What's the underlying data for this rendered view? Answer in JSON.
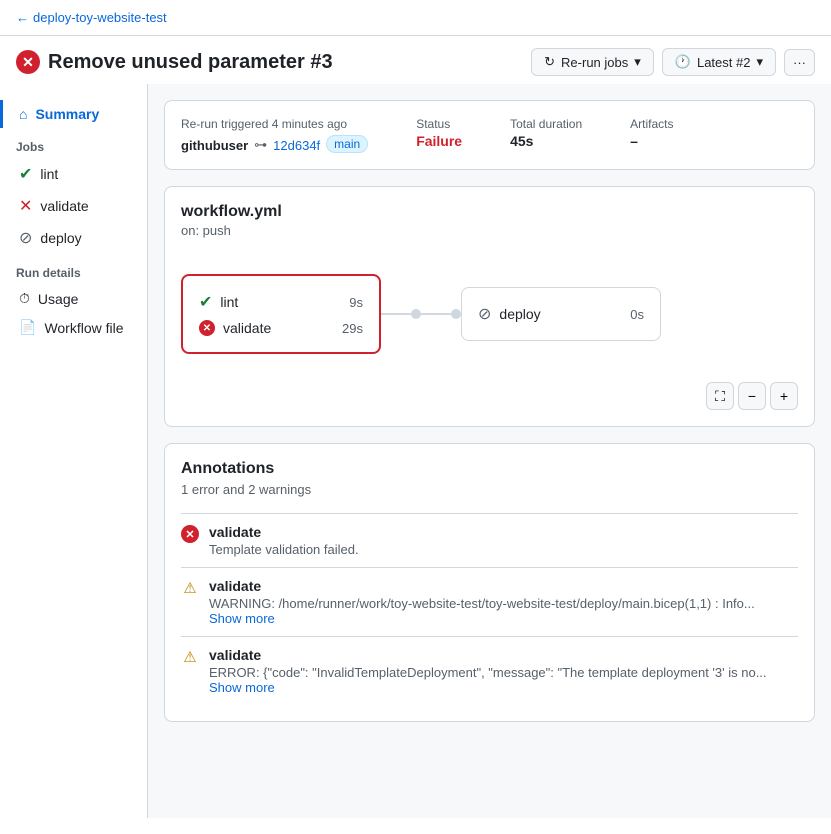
{
  "breadcrumb": {
    "back_text": "deploy-toy-website-test"
  },
  "header": {
    "title": "Remove unused parameter #3",
    "actions": {
      "rerun_label": "Re-run jobs",
      "latest_label": "Latest #2",
      "more_label": "···"
    }
  },
  "sidebar": {
    "summary_label": "Summary",
    "jobs_section": "Jobs",
    "jobs": [
      {
        "name": "lint",
        "status": "success"
      },
      {
        "name": "validate",
        "status": "failure"
      },
      {
        "name": "deploy",
        "status": "skipped"
      }
    ],
    "run_details_section": "Run details",
    "run_details": [
      {
        "name": "Usage",
        "icon": "clock"
      },
      {
        "name": "Workflow file",
        "icon": "workflow"
      }
    ]
  },
  "summary_card": {
    "triggered_label": "Re-run triggered 4 minutes ago",
    "user": "githubuser",
    "commit": "12d634f",
    "branch": "main",
    "status_label": "Status",
    "status_value": "Failure",
    "duration_label": "Total duration",
    "duration_value": "45s",
    "artifacts_label": "Artifacts",
    "artifacts_value": "–"
  },
  "workflow_card": {
    "filename": "workflow.yml",
    "trigger": "on: push",
    "jobs": [
      {
        "name": "lint",
        "status": "success",
        "duration": "9s",
        "highlighted": true
      },
      {
        "name": "validate",
        "status": "failure",
        "duration": "29s",
        "highlighted": true
      }
    ],
    "deploy_job": {
      "name": "deploy",
      "status": "skipped",
      "duration": "0s"
    }
  },
  "annotations": {
    "title": "Annotations",
    "subtitle": "1 error and 2 warnings",
    "items": [
      {
        "type": "error",
        "job": "validate",
        "message": "Template validation failed.",
        "show_more": false
      },
      {
        "type": "warning",
        "job": "validate",
        "message": "WARNING: /home/runner/work/toy-website-test/toy-website-test/deploy/main.bicep(1,1) : Info...",
        "show_more": true,
        "show_more_label": "Show more"
      },
      {
        "type": "warning",
        "job": "validate",
        "message": "ERROR: {\"code\": \"InvalidTemplateDeployment\", \"message\": \"The template deployment '3' is no...",
        "show_more": true,
        "show_more_label": "Show more"
      }
    ]
  }
}
